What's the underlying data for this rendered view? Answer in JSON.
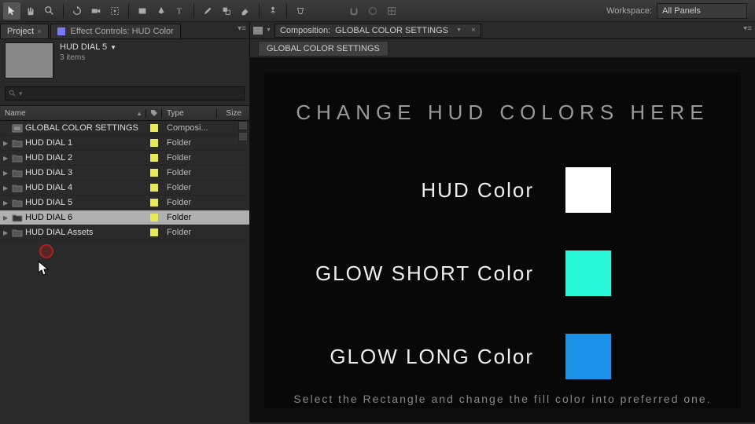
{
  "workspace": {
    "label": "Workspace:",
    "value": "All Panels"
  },
  "panels": {
    "project_tab": "Project",
    "effect_controls_tab": "Effect Controls: HUD Color"
  },
  "project": {
    "selected_title": "HUD DIAL 5",
    "selected_sub": "3 items"
  },
  "columns": {
    "name": "Name",
    "type": "Type",
    "size": "Size"
  },
  "items": [
    {
      "name": "GLOBAL COLOR SETTINGS",
      "type": "Composi...",
      "kind": "comp"
    },
    {
      "name": "HUD DIAL 1",
      "type": "Folder",
      "kind": "folder"
    },
    {
      "name": "HUD DIAL 2",
      "type": "Folder",
      "kind": "folder"
    },
    {
      "name": "HUD DIAL 3",
      "type": "Folder",
      "kind": "folder"
    },
    {
      "name": "HUD DIAL 4",
      "type": "Folder",
      "kind": "folder"
    },
    {
      "name": "HUD DIAL 5",
      "type": "Folder",
      "kind": "folder"
    },
    {
      "name": "HUD DIAL 6",
      "type": "Folder",
      "kind": "folder",
      "selected": true
    },
    {
      "name": "HUD DIAL Assets",
      "type": "Folder",
      "kind": "folder"
    }
  ],
  "composition": {
    "prefix": "Composition:",
    "name": "GLOBAL COLOR SETTINGS",
    "sub_tab": "GLOBAL COLOR SETTINGS"
  },
  "canvas": {
    "title": "CHANGE HUD COLORS HERE",
    "rows": [
      {
        "label": "HUD Color",
        "color": "#ffffff"
      },
      {
        "label": "GLOW SHORT Color",
        "color": "#27f7d9"
      },
      {
        "label": "GLOW LONG Color",
        "color": "#1b92e8"
      }
    ],
    "footer": "Select the Rectangle and change the fill color into preferred one."
  }
}
